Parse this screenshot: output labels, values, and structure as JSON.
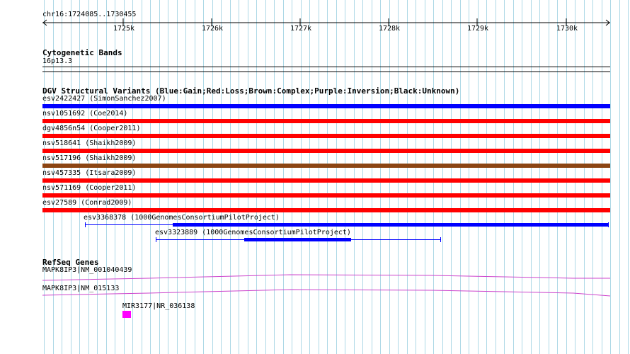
{
  "position": "chr16:1724085..1730455",
  "ruler": {
    "ticks": [
      "1725k",
      "1726k",
      "1727k",
      "1728k",
      "1729k",
      "1730k"
    ]
  },
  "cyto": {
    "title": "Cytogenetic Bands",
    "band": "16p13.3"
  },
  "dgv": {
    "title": "DGV Structural Variants (Blue:Gain;Red:Loss;Brown:Complex;Purple:Inversion;Black:Unknown)",
    "full_rows": [
      {
        "label": "esv2422427 (SimonSanchez2007)",
        "type": "Gain"
      },
      {
        "label": "nsv1051692 (Coe2014)",
        "type": "Loss"
      },
      {
        "label": "dgv4856n54 (Cooper2011)",
        "type": "Loss"
      },
      {
        "label": "nsv518641 (Shaikh2009)",
        "type": "Loss"
      },
      {
        "label": "nsv517196 (Shaikh2009)",
        "type": "Complex"
      },
      {
        "label": "nsv457335 (Itsara2009)",
        "type": "Loss"
      },
      {
        "label": "nsv571169 (Cooper2011)",
        "type": "Loss"
      },
      {
        "label": "esv27589 (Conrad2009)",
        "type": "Loss"
      }
    ],
    "partial_rows": [
      {
        "label": "esv3368378 (1000GenomesConsortiumPilotProject)",
        "type": "Gain"
      },
      {
        "label": "esv3323889 (1000GenomesConsortiumPilotProject)",
        "type": "Gain"
      }
    ]
  },
  "refseq": {
    "title": "RefSeq Genes",
    "genes": [
      {
        "label": "MAPK8IP3|NM_001040439"
      },
      {
        "label": "MAPK8IP3|NM_015133"
      },
      {
        "label": "MIR3177|NR_036138"
      }
    ]
  },
  "colors": {
    "Gain": "#0000ff",
    "Loss": "#ff0000",
    "Complex": "#8b4513",
    "gene": "#cc44cc",
    "mirna": "#ff00ff",
    "grid": "#add8e6"
  }
}
